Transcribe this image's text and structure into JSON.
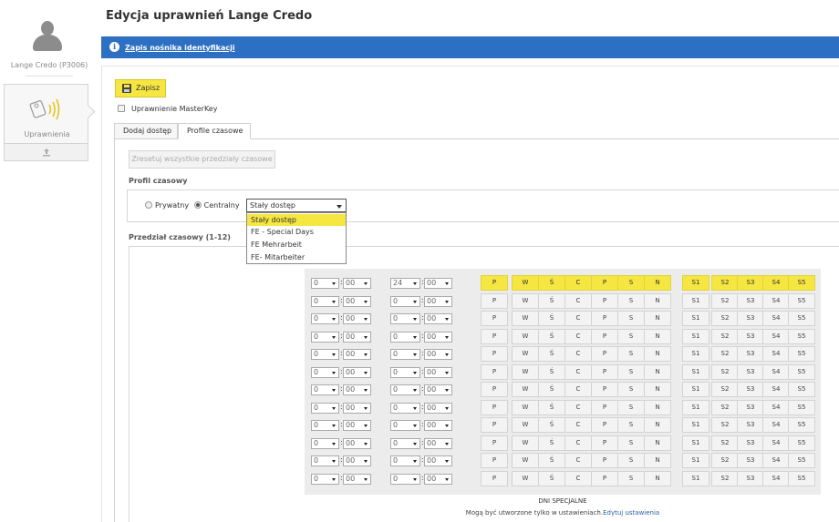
{
  "sidebar": {
    "user_name": "Lange Credo (P3006)",
    "permissions_label": "Uprawnienia"
  },
  "page": {
    "title": "Edycja uprawnień Lange Credo"
  },
  "info_bar": {
    "link_text": "Zapis nośnika identyfikacji",
    "color": "#2c6fc3"
  },
  "toolbar": {
    "save_label": "Zapisz",
    "masterkey_label": "Uprawnienie MasterKey",
    "masterkey_checked": false
  },
  "tabs": [
    {
      "label": "Dodaj dostęp",
      "active": false
    },
    {
      "label": "Profile czasowe",
      "active": true
    }
  ],
  "reset_button": "Zresetuj wszystkie przedziały czasowe",
  "profile": {
    "section_label": "Profil czasowy",
    "radio_private": "Prywatny",
    "radio_central": "Centralny",
    "selected_radio": "Centralny",
    "selected_value": "Stały dostęp",
    "options": [
      "Stały dostęp",
      "FE - Special Days",
      "FE Mehrarbeit",
      "FE- Mitarbeiter"
    ]
  },
  "interval": {
    "section_label": "Przedział czasowy (1-12)",
    "day_labels": [
      "P",
      "W",
      "Ś",
      "C",
      "P",
      "S",
      "N"
    ],
    "special_labels": [
      "S1",
      "S2",
      "S3",
      "S4",
      "S5"
    ],
    "rows": [
      {
        "from_h": "0",
        "from_m": "00",
        "to_h": "24",
        "to_m": "00",
        "active": true
      },
      {
        "from_h": "0",
        "from_m": "00",
        "to_h": "0",
        "to_m": "00",
        "active": false
      },
      {
        "from_h": "0",
        "from_m": "00",
        "to_h": "0",
        "to_m": "00",
        "active": false
      },
      {
        "from_h": "0",
        "from_m": "00",
        "to_h": "0",
        "to_m": "00",
        "active": false
      },
      {
        "from_h": "0",
        "from_m": "00",
        "to_h": "0",
        "to_m": "00",
        "active": false
      },
      {
        "from_h": "0",
        "from_m": "00",
        "to_h": "0",
        "to_m": "00",
        "active": false
      },
      {
        "from_h": "0",
        "from_m": "00",
        "to_h": "0",
        "to_m": "00",
        "active": false
      },
      {
        "from_h": "0",
        "from_m": "00",
        "to_h": "0",
        "to_m": "00",
        "active": false
      },
      {
        "from_h": "0",
        "from_m": "00",
        "to_h": "0",
        "to_m": "00",
        "active": false
      },
      {
        "from_h": "0",
        "from_m": "00",
        "to_h": "0",
        "to_m": "00",
        "active": false
      },
      {
        "from_h": "0",
        "from_m": "00",
        "to_h": "0",
        "to_m": "00",
        "active": false
      },
      {
        "from_h": "0",
        "from_m": "00",
        "to_h": "0",
        "to_m": "00",
        "active": false
      }
    ],
    "active_color": "#f5e642"
  },
  "special_days": {
    "title": "DNI SPECJALNE",
    "note": "Mogą być utworzone tylko w ustawieniach.",
    "link": "Edytuj ustawienia"
  }
}
